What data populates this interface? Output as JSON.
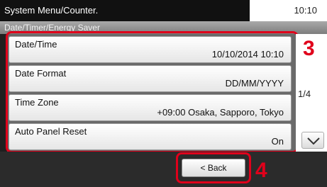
{
  "header": {
    "title": "System Menu/Counter.",
    "clock": "10:10",
    "subtitle": "Date/Timer/Energy Saver"
  },
  "items": [
    {
      "label": "Date/Time",
      "value": "10/10/2014 10:10"
    },
    {
      "label": "Date Format",
      "value": "DD/MM/YYYY"
    },
    {
      "label": "Time Zone",
      "value": "+09:00 Osaka, Sapporo, Tokyo"
    },
    {
      "label": "Auto Panel Reset",
      "value": "On"
    }
  ],
  "pagination": {
    "indicator": "1/4"
  },
  "footer": {
    "back_label": "< Back"
  },
  "callouts": {
    "list": "3",
    "back": "4"
  },
  "colors": {
    "highlight": "#e0001b"
  },
  "icons": {
    "scroll": "chevron-down-icon"
  }
}
